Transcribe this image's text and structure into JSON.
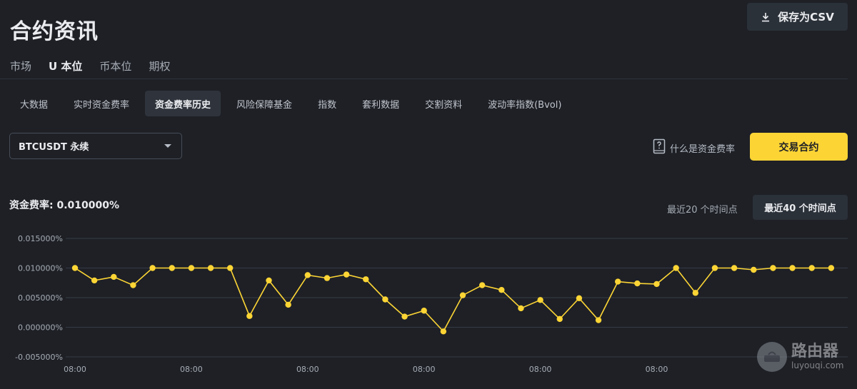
{
  "page": {
    "title": "合约资讯"
  },
  "toolbar": {
    "csv_label": "保存为CSV"
  },
  "main_tabs": [
    {
      "label": "市场"
    },
    {
      "label": "U 本位"
    },
    {
      "label": "币本位"
    },
    {
      "label": "期权"
    }
  ],
  "main_tabs_active": "U 本位",
  "sub_tabs": [
    {
      "label": "大数据"
    },
    {
      "label": "实时资金费率"
    },
    {
      "label": "资金费率历史"
    },
    {
      "label": "风险保障基金"
    },
    {
      "label": "指数"
    },
    {
      "label": "套利数据"
    },
    {
      "label": "交割资料"
    },
    {
      "label": "波动率指数(Bvol)"
    }
  ],
  "sub_tabs_active": "资金费率历史",
  "symbol_select": {
    "value": "BTCUSDT 永续"
  },
  "help": {
    "label": "什么是资金费率"
  },
  "trade_button": {
    "label": "交易合约"
  },
  "funding": {
    "label": "资金费率:",
    "value": "0.010000%"
  },
  "range": {
    "recent20": "最近20 个时间点",
    "recent40": "最近40 个时间点"
  },
  "watermark": {
    "cn": "路由器",
    "en": "luyouqi.com"
  },
  "colors": {
    "accent": "#fcd535",
    "background": "#1e2026",
    "panel": "#2b3139"
  },
  "chart_data": {
    "type": "line",
    "ylim": [
      -0.005,
      0.015
    ],
    "y_ticks": [
      "0.015000%",
      "0.010000%",
      "0.005000%",
      "0.000000%",
      "-0.005000%"
    ],
    "x_ticks": [
      "08:00",
      "08:00",
      "08:00",
      "08:00",
      "08:00",
      "08:00"
    ],
    "x_tick_index": [
      0,
      6,
      12,
      18,
      24,
      30
    ],
    "grid": true,
    "series": [
      {
        "values": [
          0.01,
          0.0079,
          0.0085,
          0.0071,
          0.01,
          0.01,
          0.01,
          0.01,
          0.01,
          0.0019,
          0.0079,
          0.0038,
          0.0088,
          0.0083,
          0.0089,
          0.0081,
          0.0047,
          0.0018,
          0.0028,
          -0.0007,
          0.0054,
          0.0071,
          0.0063,
          0.0032,
          0.0046,
          0.0014,
          0.0049,
          0.0012,
          0.0077,
          0.0074,
          0.0073,
          0.01,
          0.0058,
          0.01,
          0.01,
          0.0097,
          0.01,
          0.01,
          0.01,
          0.01
        ]
      }
    ]
  }
}
